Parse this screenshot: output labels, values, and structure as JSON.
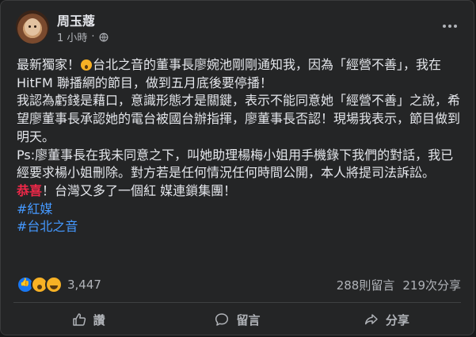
{
  "post": {
    "author": "周玉蔻",
    "time": "1 小時",
    "separator": "·",
    "privacy_icon": "globe-icon",
    "more_icon": "more-options-icon",
    "paragraphs": [
      {
        "before_emoji": "最新獨家！",
        "emoji": "astonished-face-emoji",
        "after_emoji": "台北之音的董事長廖婉池剛剛通知我，因為「經營不善」，我在HitFM 聯播網的節目，做到五月底後要停播！"
      },
      {
        "text": "我認為虧錢是藉口，意識形態才是關鍵，表示不能同意她「經營不善」之說，希望廖董事長承認她的電台被國台辦指揮，廖董事長否認！現場我表示，節目做到明天。"
      },
      {
        "text": "Ps:廖董事長在我未同意之下，叫她助理楊梅小姐用手機錄下我們的對話，我已經要求楊小姐刪除。對方若是任何情況任何時間公開，本人將提司法訴訟。"
      },
      {
        "highlight": "恭喜",
        "rest": "！台灣又多了一個紅 媒連鎖集團！"
      }
    ],
    "hashtags": [
      "#紅媒",
      "#台北之音"
    ]
  },
  "stats": {
    "reactions": [
      "like",
      "wow",
      "haha"
    ],
    "reaction_count": "3,447",
    "comments": "288則留言",
    "shares": "219次分享"
  },
  "actions": {
    "like": "讚",
    "comment": "留言",
    "share": "分享"
  },
  "colors": {
    "background": "#18191a",
    "card": "#242526",
    "text": "#e4e6eb",
    "secondary": "#b0b3b8",
    "hashtag": "#4599ff",
    "highlight": "#f02849"
  }
}
